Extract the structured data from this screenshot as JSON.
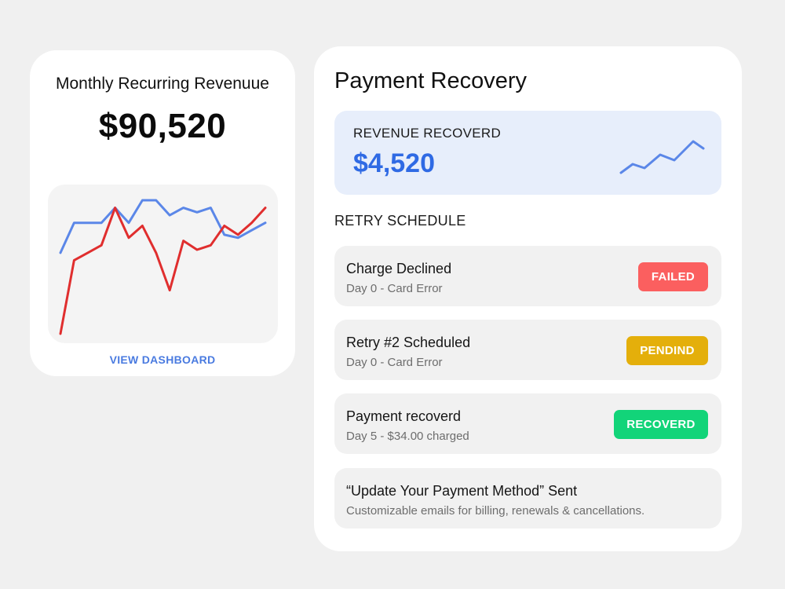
{
  "mrr": {
    "title": "Monthly Recurring Revenuue",
    "value": "$90,520",
    "link_label": "VIEW DASHBOARD",
    "chart_data": {
      "type": "line",
      "series": [
        {
          "color": "#5b87e8",
          "values": [
            10,
            30,
            30,
            30,
            40,
            30,
            45,
            45,
            35,
            40,
            37,
            40,
            22,
            20,
            25,
            30
          ]
        },
        {
          "color": "#e02e2e",
          "values": [
            -44,
            5,
            10,
            15,
            40,
            20,
            28,
            10,
            -15,
            18,
            12,
            15,
            28,
            22,
            30,
            40
          ]
        }
      ]
    }
  },
  "recovery": {
    "title": "Payment Recovery",
    "revenue_label": "REVENUE RECOVERD",
    "revenue_value": "$4,520",
    "spark_color": "#5b87e8",
    "retry_heading": "RETRY SCHEDULE",
    "items": [
      {
        "title": "Charge Declined",
        "subtitle": "Day 0 - Card Error",
        "status": "FAILED",
        "status_color": "#fb5f5f"
      },
      {
        "title": "Retry #2 Scheduled",
        "subtitle": "Day 0 - Card Error",
        "status": "PENDIND",
        "status_color": "#e4af0b"
      },
      {
        "title": "Payment recoverd",
        "subtitle": "Day 5 - $34.00 charged",
        "status": "RECOVERD",
        "status_color": "#12d479"
      },
      {
        "title": "“Update Your Payment Method” Sent",
        "subtitle": "Customizable emails for billing, renewals & cancellations."
      }
    ]
  }
}
